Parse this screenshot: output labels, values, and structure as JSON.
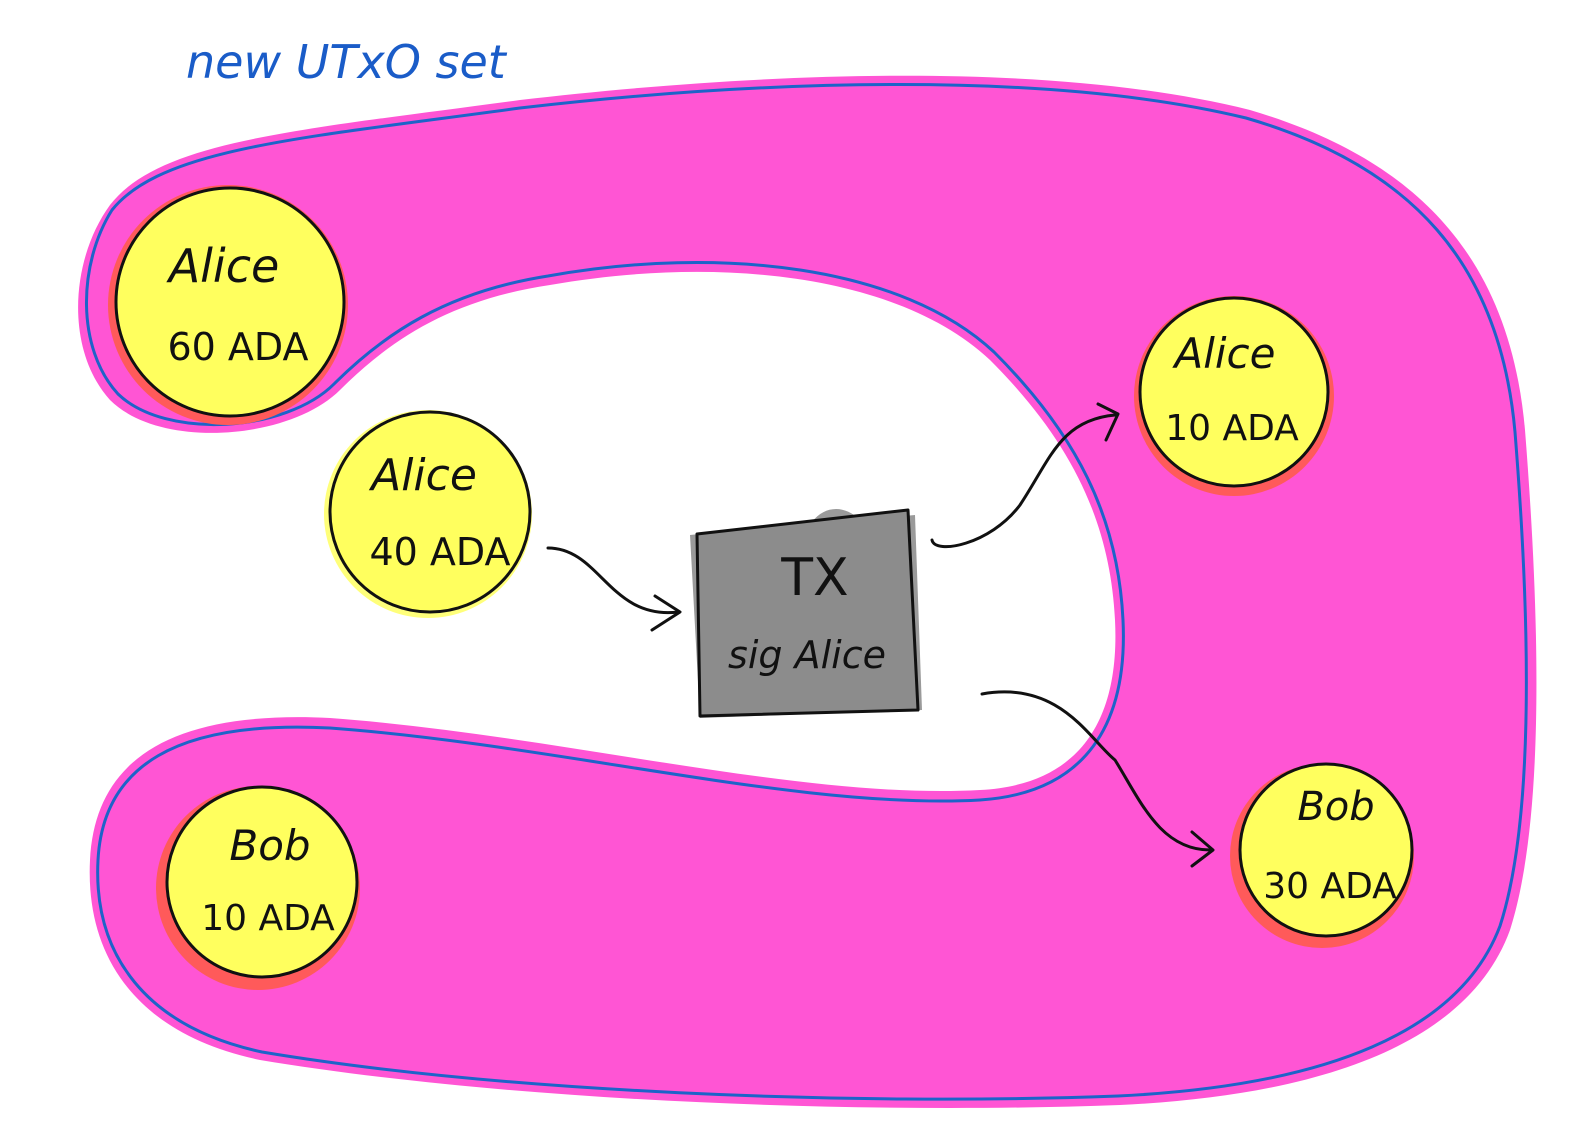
{
  "set_label": "new UTxO set",
  "colors": {
    "set_fill": "#ff55d4",
    "set_outline": "#1e63c8",
    "label_color": "#1a5cc8",
    "utxo_fill": "#ffff5e",
    "utxo_halo": "#ff5a5a",
    "utxo_outline": "#111111",
    "tx_fill": "#8c8c8c",
    "tx_shadow": "#9a9a9a",
    "arrow": "#111111"
  },
  "utxos": {
    "alice_60": {
      "owner": "Alice",
      "amount": "60 ADA"
    },
    "bob_10": {
      "owner": "Bob",
      "amount": "10 ADA"
    },
    "alice_40": {
      "owner": "Alice",
      "amount": "40 ADA"
    },
    "alice_10": {
      "owner": "Alice",
      "amount": "10 ADA"
    },
    "bob_30": {
      "owner": "Bob",
      "amount": "30 ADA"
    }
  },
  "tx": {
    "title": "TX",
    "signature": "sig Alice"
  }
}
